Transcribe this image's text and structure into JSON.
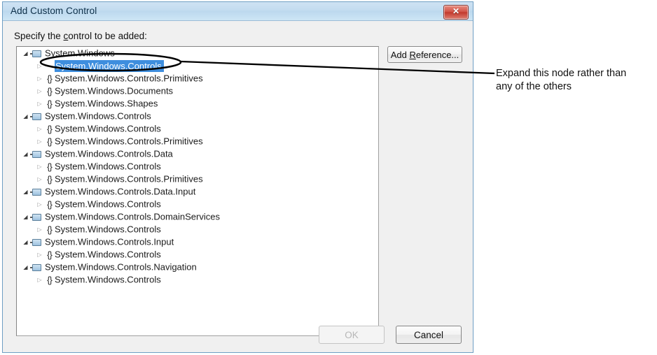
{
  "window": {
    "title": "Add Custom Control",
    "close_label": "✖",
    "close_icon": "close-icon"
  },
  "dialog": {
    "prompt_before": "Specify the ",
    "prompt_accel": "c",
    "prompt_after": "ontrol to be added:",
    "prompt_full": "Specify the control to be added:"
  },
  "add_reference_button": {
    "before": "Add ",
    "accel": "R",
    "after": "eference..."
  },
  "footer": {
    "ok_label": "OK",
    "ok_enabled": false,
    "cancel_label": "Cancel"
  },
  "tree": {
    "selected_index": 1,
    "rows": [
      {
        "level": 0,
        "expander": "open",
        "icon": "assembly-icon",
        "label": "System.Windows"
      },
      {
        "level": 1,
        "expander": "closed",
        "icon": "namespace-icon",
        "label": "System.Windows.Controls"
      },
      {
        "level": 1,
        "expander": "closed",
        "icon": "namespace-icon",
        "label": "System.Windows.Controls.Primitives"
      },
      {
        "level": 1,
        "expander": "closed",
        "icon": "namespace-icon",
        "label": "System.Windows.Documents"
      },
      {
        "level": 1,
        "expander": "closed",
        "icon": "namespace-icon",
        "label": "System.Windows.Shapes"
      },
      {
        "level": 0,
        "expander": "open",
        "icon": "assembly-icon",
        "label": "System.Windows.Controls"
      },
      {
        "level": 1,
        "expander": "closed",
        "icon": "namespace-icon",
        "label": "System.Windows.Controls"
      },
      {
        "level": 1,
        "expander": "closed",
        "icon": "namespace-icon",
        "label": "System.Windows.Controls.Primitives"
      },
      {
        "level": 0,
        "expander": "open",
        "icon": "assembly-icon",
        "label": "System.Windows.Controls.Data"
      },
      {
        "level": 1,
        "expander": "closed",
        "icon": "namespace-icon",
        "label": "System.Windows.Controls"
      },
      {
        "level": 1,
        "expander": "closed",
        "icon": "namespace-icon",
        "label": "System.Windows.Controls.Primitives"
      },
      {
        "level": 0,
        "expander": "open",
        "icon": "assembly-icon",
        "label": "System.Windows.Controls.Data.Input"
      },
      {
        "level": 1,
        "expander": "closed",
        "icon": "namespace-icon",
        "label": "System.Windows.Controls"
      },
      {
        "level": 0,
        "expander": "open",
        "icon": "assembly-icon",
        "label": "System.Windows.Controls.DomainServices"
      },
      {
        "level": 1,
        "expander": "closed",
        "icon": "namespace-icon",
        "label": "System.Windows.Controls"
      },
      {
        "level": 0,
        "expander": "open",
        "icon": "assembly-icon",
        "label": "System.Windows.Controls.Input"
      },
      {
        "level": 1,
        "expander": "closed",
        "icon": "namespace-icon",
        "label": "System.Windows.Controls"
      },
      {
        "level": 0,
        "expander": "open",
        "icon": "assembly-icon",
        "label": "System.Windows.Controls.Navigation"
      },
      {
        "level": 1,
        "expander": "closed",
        "icon": "namespace-icon",
        "label": "System.Windows.Controls"
      }
    ]
  },
  "annotation": {
    "line1": "Expand this node rather than",
    "line2": "any of the others",
    "full_text": "Expand this node rather than any of the others"
  },
  "colors": {
    "selection_blue": "#3e8ede",
    "titlebar_blue": "#c3dcf0",
    "close_red": "#c2392d",
    "dialog_face": "#f0f0f0",
    "annotation_black": "#101010"
  }
}
